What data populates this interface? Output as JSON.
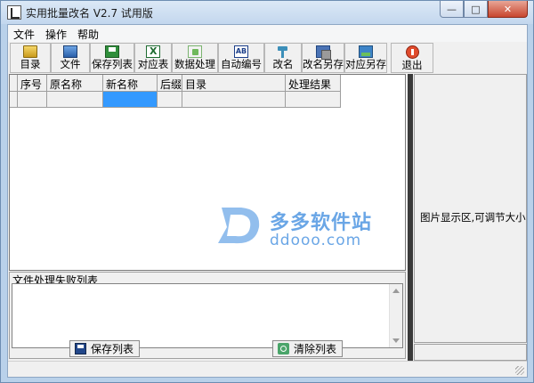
{
  "window": {
    "title": "实用批量改名 V2.7 试用版",
    "controls": [
      "minimize",
      "maximize",
      "close"
    ]
  },
  "menu": [
    "文件",
    "操作",
    "帮助"
  ],
  "toolbar": [
    {
      "label": "目录",
      "icon": "folder-icon"
    },
    {
      "label": "文件",
      "icon": "file-icon"
    },
    {
      "label": "保存列表",
      "icon": "save-icon"
    },
    {
      "label": "对应表",
      "icon": "excel-icon"
    },
    {
      "label": "数据处理",
      "icon": "data-icon"
    },
    {
      "label": "自动编号",
      "icon": "numbering-icon"
    },
    {
      "label": "改名",
      "icon": "hammer-icon"
    },
    {
      "label": "改名另存",
      "icon": "save-as-icon"
    },
    {
      "label": "对应另存",
      "icon": "picture-icon"
    },
    {
      "label": "退出",
      "icon": "exit-icon"
    }
  ],
  "grid": {
    "columns": [
      "序号",
      "原名称",
      "新名称",
      "后缀",
      "目录",
      "处理结果"
    ],
    "selected_cell": "新名称"
  },
  "watermark": {
    "brand": "多多软件站",
    "url": "ddooo.com"
  },
  "fail_list": {
    "label": "文件处理失败列表"
  },
  "buttons": {
    "save_list": "保存列表",
    "clear_list": "清除列表"
  },
  "image_pane": {
    "text": "图片显示区,可调节大小"
  },
  "colors": {
    "selection": "#3399ff",
    "watermark": "#6aa6e6"
  }
}
